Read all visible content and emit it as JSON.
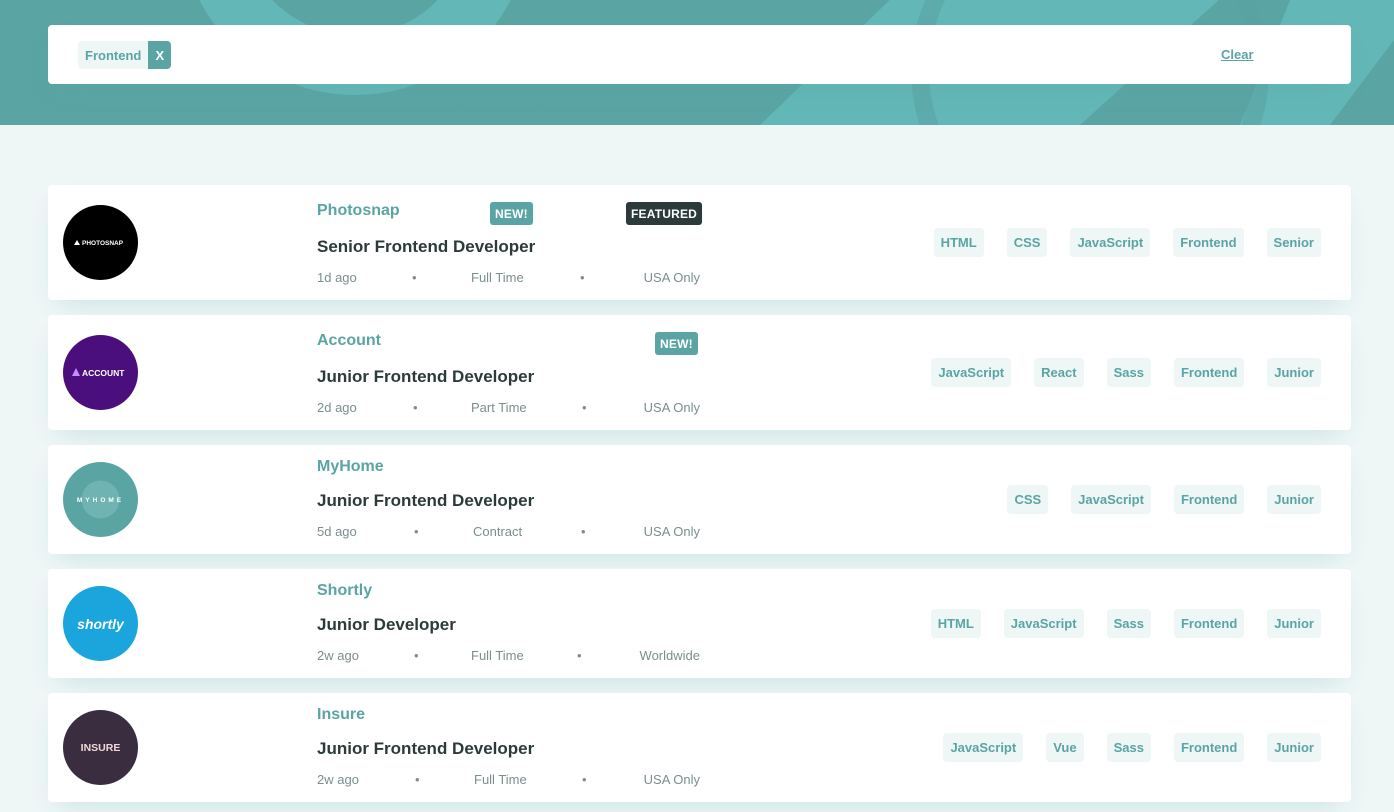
{
  "filters": {
    "active": [
      {
        "label": "Frontend",
        "remove_label": "X"
      }
    ],
    "clear_label": "Clear"
  },
  "colors": {
    "primary": "#5ba4a4",
    "dark": "#2c3a3a",
    "background": "#eef6f6",
    "tag_background": "#eef6f6"
  },
  "jobs": [
    {
      "company": "Photosnap",
      "logo_text": "PHOTOSNAP",
      "logo_icon": "photosnap-logo-icon",
      "logo_bg": "#000000",
      "new_label": "NEW!",
      "featured_label": "FEATURED",
      "position": "Senior Frontend Developer",
      "posted": "1d ago",
      "sep1": "•",
      "contract": "Full Time",
      "sep2": "•",
      "location": "USA Only",
      "tags": [
        "HTML",
        "CSS",
        "JavaScript",
        "Frontend",
        "Senior"
      ]
    },
    {
      "company": "Account",
      "logo_text": "ACCOUNT",
      "logo_icon": "account-logo-icon",
      "logo_bg": "#4a0f7d",
      "new_label": "NEW!",
      "position": "Junior Frontend Developer",
      "posted": "2d ago",
      "sep1": "•",
      "contract": "Part Time",
      "sep2": "•",
      "location": "USA Only",
      "tags": [
        "JavaScript",
        "React",
        "Sass",
        "Frontend",
        "Junior"
      ]
    },
    {
      "company": "MyHome",
      "logo_text": "MYHOME",
      "logo_icon": "myhome-logo-icon",
      "logo_bg": "#5ba4a4",
      "position": "Junior Frontend Developer",
      "posted": "5d ago",
      "sep1": "•",
      "contract": "Contract",
      "sep2": "•",
      "location": "USA Only",
      "tags": [
        "CSS",
        "JavaScript",
        "Frontend",
        "Junior"
      ]
    },
    {
      "company": "Shortly",
      "logo_text": "shortly",
      "logo_icon": "shortly-logo-icon",
      "logo_bg": "#1aa6dd",
      "position": "Junior Developer",
      "posted": "2w ago",
      "sep1": "•",
      "contract": "Full Time",
      "sep2": "•",
      "location": "Worldwide",
      "tags": [
        "HTML",
        "JavaScript",
        "Sass",
        "Frontend",
        "Junior"
      ]
    },
    {
      "company": "Insure",
      "logo_text": "INSURE",
      "logo_icon": "insure-logo-icon",
      "logo_bg": "#3a2d3f",
      "position": "Junior Frontend Developer",
      "posted": "2w ago",
      "sep1": "•",
      "contract": "Full Time",
      "sep2": "•",
      "location": "USA Only",
      "tags": [
        "JavaScript",
        "Vue",
        "Sass",
        "Frontend",
        "Junior"
      ]
    }
  ]
}
